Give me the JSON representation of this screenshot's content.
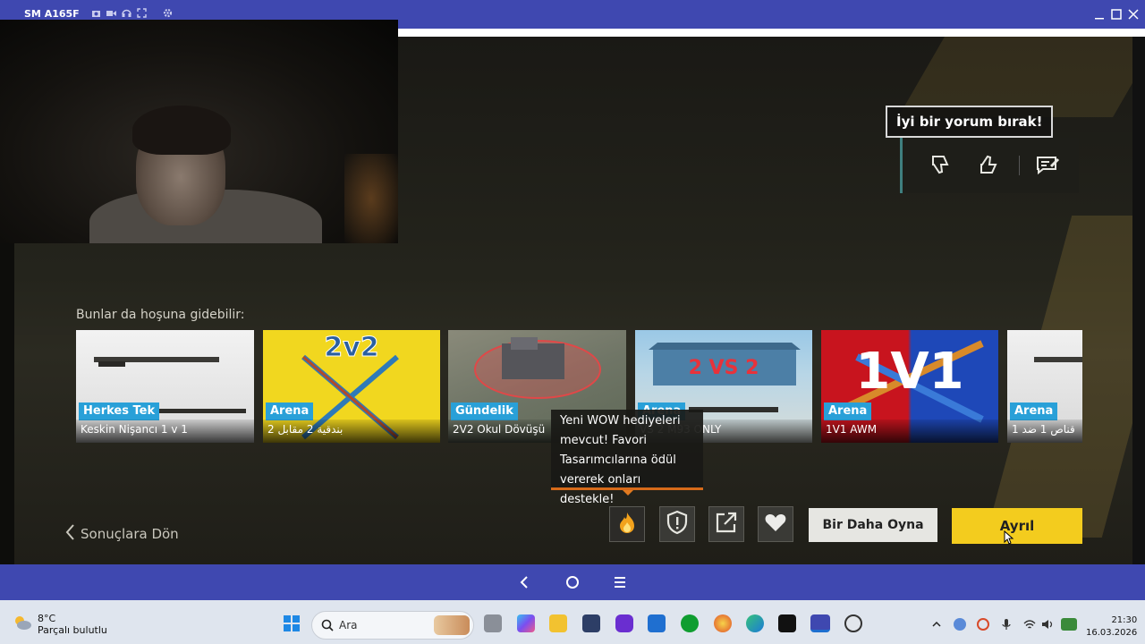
{
  "window": {
    "device_name": "SM A165F",
    "toolbar_icons": [
      "camera-icon",
      "video-icon",
      "headset-icon",
      "fullscreen-icon",
      "gear-icon"
    ],
    "controls": [
      "minimize-icon",
      "maximize-icon",
      "close-icon"
    ]
  },
  "game": {
    "rating": {
      "prompt": "İyi bir yorum bırak!",
      "icons": [
        "thumbs-down-icon",
        "thumbs-up-icon",
        "comment-icon"
      ]
    },
    "suggestions_title": "Bunlar da hoşuna gidebilir:",
    "cards": [
      {
        "tag": "Herkes Tek",
        "name": "Keskin Nişancı 1 v 1",
        "thumb_text": ""
      },
      {
        "tag": "Arena",
        "name": "2 بندقية 2 مقابل",
        "thumb_text": "2v2"
      },
      {
        "tag": "Gündelik",
        "name": "2V2 Okul Dövüşü",
        "thumb_text": ""
      },
      {
        "tag": "Arena",
        "name": "VS 2 M93 ONLY",
        "thumb_text": "2 VS 2"
      },
      {
        "tag": "Arena",
        "name": "1V1 AWM",
        "thumb_text": "1V1"
      },
      {
        "tag": "Arena",
        "name": "قناص 1 ضد 1",
        "thumb_text": ""
      }
    ],
    "tooltip": "Yeni WOW hediyeleri mevcut! Favori Tasarımcılarına ödül vererek onları destekle!",
    "back_label": "Sonuçlara Dön",
    "action_icons": [
      "flame-gift-icon",
      "shield-report-icon",
      "share-icon",
      "heart-icon"
    ],
    "replay_label": "Bir Daha Oyna",
    "leave_label": "Ayrıl"
  },
  "android_nav": {
    "icons": [
      "back-icon",
      "home-icon",
      "menu-icon"
    ]
  },
  "taskbar": {
    "weather_temp": "8°C",
    "weather_desc": "Parçalı bulutlu",
    "search_placeholder": "Ara",
    "time": "21:30",
    "date": "16.03.2026"
  }
}
